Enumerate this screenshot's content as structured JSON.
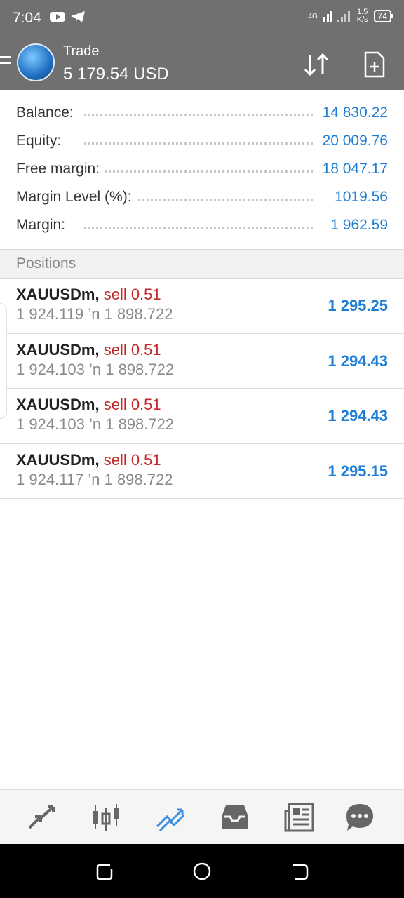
{
  "status_bar": {
    "time": "7:04",
    "network": "4G",
    "speed_value": "1.5",
    "speed_unit": "K/s",
    "battery": "74"
  },
  "app_bar": {
    "title": "Trade",
    "balance": "5 179.54 USD"
  },
  "summary": [
    {
      "label": "Balance:",
      "value": "14 830.22"
    },
    {
      "label": "Equity:",
      "value": "20 009.76"
    },
    {
      "label": "Free margin:",
      "value": "18 047.17"
    },
    {
      "label": "Margin Level (%):",
      "value": "1019.56"
    },
    {
      "label": "Margin:",
      "value": "1 962.59"
    }
  ],
  "positions": {
    "header": "Positions",
    "items": [
      {
        "symbol": "XAUUSDm,",
        "type": "sell 0.51",
        "prices": "1 924.119 ’n  1 898.722",
        "profit": "1 295.25"
      },
      {
        "symbol": "XAUUSDm,",
        "type": "sell 0.51",
        "prices": "1 924.103 ’n  1 898.722",
        "profit": "1 294.43"
      },
      {
        "symbol": "XAUUSDm,",
        "type": "sell 0.51",
        "prices": "1 924.103 ’n  1 898.722",
        "profit": "1 294.43"
      },
      {
        "symbol": "XAUUSDm,",
        "type": "sell 0.51",
        "prices": "1 924.117 ’n  1 898.722",
        "profit": "1 295.15"
      }
    ]
  },
  "bottom_nav": [
    {
      "icon": "quotes-icon",
      "active": false
    },
    {
      "icon": "chart-icon",
      "active": false
    },
    {
      "icon": "trade-icon",
      "active": true
    },
    {
      "icon": "history-icon",
      "active": false
    },
    {
      "icon": "news-icon",
      "active": false
    },
    {
      "icon": "chat-icon",
      "active": false
    }
  ],
  "colors": {
    "accent_blue": "#1e7ed6",
    "sell_red": "#c62828",
    "header_gray": "#707070"
  }
}
